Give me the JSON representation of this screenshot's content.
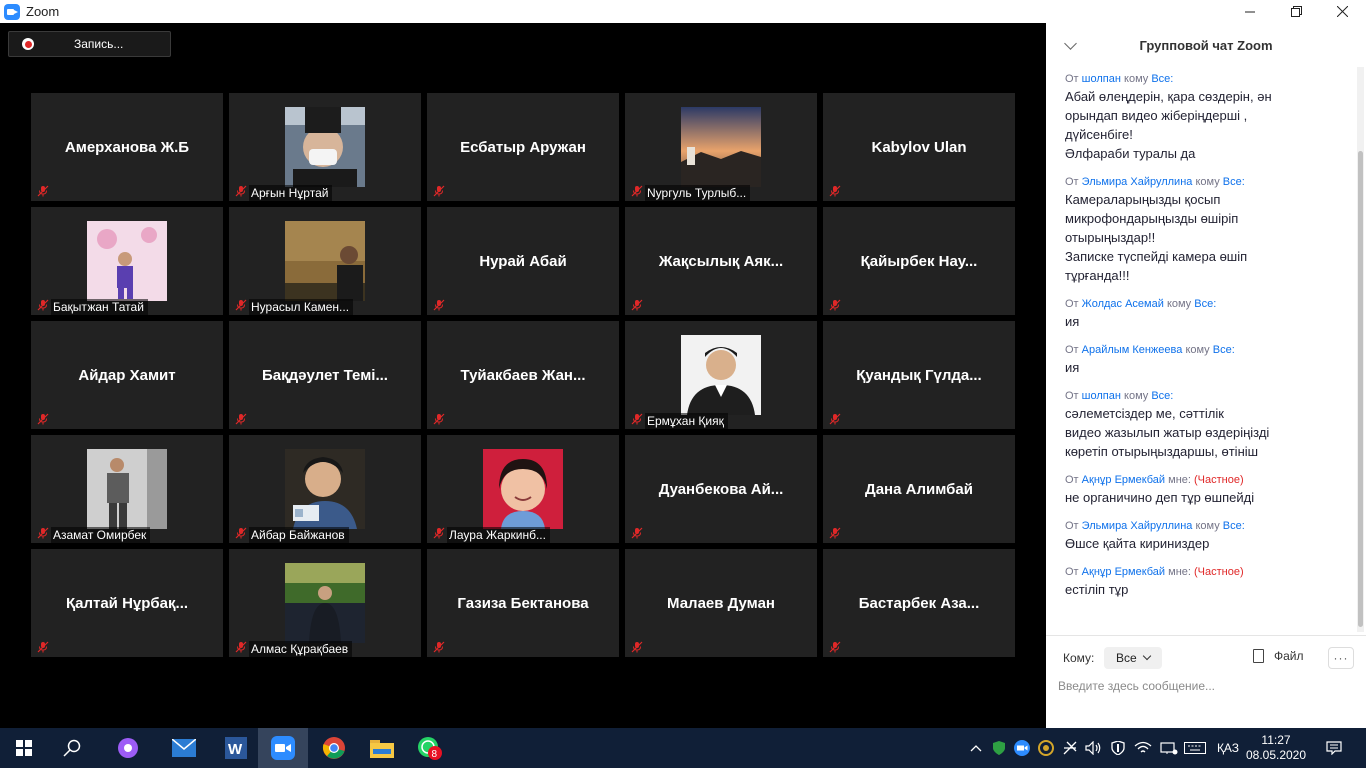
{
  "window": {
    "title": "Zoom",
    "minimize_icon": "minimize-icon",
    "maximize_icon": "restore-icon",
    "close_icon": "close-icon"
  },
  "recording": {
    "label": "Запись..."
  },
  "participants": [
    {
      "name": "Амерханова Ж.Б",
      "video": false
    },
    {
      "name": "Арғын Нұртай",
      "video": true,
      "photo": "masked-person"
    },
    {
      "name": "Есбатыр Аружан",
      "video": false
    },
    {
      "name": "Nургуль Турлыб...",
      "video": true,
      "photo": "sunset"
    },
    {
      "name": "Kabylov Ulan",
      "video": false
    },
    {
      "name": "Бақытжан Татай",
      "video": true,
      "photo": "child-pink"
    },
    {
      "name": "Нурасыл Камен...",
      "video": true,
      "photo": "person-wall"
    },
    {
      "name": "Нурай Абай",
      "video": false
    },
    {
      "name": "Жақсылық Аяк...",
      "video": false
    },
    {
      "name": "Қайырбек  Нау...",
      "video": false
    },
    {
      "name": "Айдар Хамит",
      "video": false
    },
    {
      "name": "Бақдәулет  Темі...",
      "video": false
    },
    {
      "name": "Туйакбаев  Жан...",
      "video": false
    },
    {
      "name": "Ермұхан Қияқ",
      "video": true,
      "photo": "portrait-suit"
    },
    {
      "name": "Қуандық Гүлда...",
      "video": false
    },
    {
      "name": "Азамат Омирбек",
      "video": true,
      "photo": "person-standing"
    },
    {
      "name": "Айбар Байжанов",
      "video": true,
      "photo": "person-card"
    },
    {
      "name": "Лаура Жаркинб...",
      "video": true,
      "photo": "girl-red"
    },
    {
      "name": "Дуанбекова  Ай...",
      "video": false
    },
    {
      "name": "Дана Алимбай",
      "video": false
    },
    {
      "name": "Қалтай  Нұрбақ...",
      "video": false
    },
    {
      "name": "Алмас Құрақбаев",
      "video": true,
      "photo": "stadium"
    },
    {
      "name": "Газиза Бектанова",
      "video": false
    },
    {
      "name": "Малаев Думан",
      "video": false
    },
    {
      "name": "Бастарбек  Аза...",
      "video": false
    }
  ],
  "chat": {
    "title": "Групповой чат Zoom",
    "messages": [
      {
        "from": "шолпан",
        "kw_from": "От",
        "kw_to": "кому",
        "to": "Все:",
        "private": "",
        "text": "Абай өлеңдерін, қара сөздерін, ән\nорындап видео жіберіңдерші ,\nдүйсенбіге!\nӘлфараби туралы да"
      },
      {
        "from": "Эльмира Хайруллина",
        "kw_from": "От",
        "kw_to": "кому",
        "to": "Все:",
        "private": "",
        "text": "Камераларыңызды қосып\nмикрофондарыңызды өшіріп\nотырыңыздар!!\nЗаписке түспейді камера өшіп\nтұрғанда!!!"
      },
      {
        "from": "Жолдас Асемай",
        "kw_from": "От",
        "kw_to": "кому",
        "to": "Все:",
        "private": "",
        "text": "ия"
      },
      {
        "from": "Арайлым Кенжеева",
        "kw_from": "От",
        "kw_to": "кому",
        "to": "Все:",
        "private": "",
        "text": "ия"
      },
      {
        "from": "шолпан",
        "kw_from": "От",
        "kw_to": "кому",
        "to": "Все:",
        "private": "",
        "text": "сәлеметсіздер ме, сәттілік\nвидео жазылып жатыр өздеріңізді\nкөретіп отырыңыздаршы, өтініш"
      },
      {
        "from": "Ақнұр Ермекбай",
        "kw_from": "От",
        "kw_to": "мне:",
        "to": "",
        "private": "(Частное)",
        "text": "не органичино деп тұр өшпейді"
      },
      {
        "from": "Эльмира Хайруллина",
        "kw_from": "От",
        "kw_to": "кому",
        "to": "Все:",
        "private": "",
        "text": "Өшсе қайта кириниздер"
      },
      {
        "from": "Ақнұр Ермекбай",
        "kw_from": "От",
        "kw_to": "мне:",
        "to": "",
        "private": "(Частное)",
        "text": "естіліп тұр"
      }
    ],
    "to_label": "Кому:",
    "to_value": "Все",
    "file_label": "Файл",
    "more_label": "···",
    "input_placeholder": "Введите здесь сообщение..."
  },
  "taskbar": {
    "apps": [
      "start",
      "search",
      "alice",
      "mail",
      "word",
      "zoom",
      "chrome",
      "explorer",
      "whatsapp"
    ],
    "whatsapp_badge": "8",
    "language": "ҚАЗ",
    "time": "11:27",
    "date": "08.05.2020"
  },
  "colors": {
    "accent": "#0e71eb",
    "private": "#e02828",
    "tile": "#222222",
    "taskbar": "#101f37"
  }
}
